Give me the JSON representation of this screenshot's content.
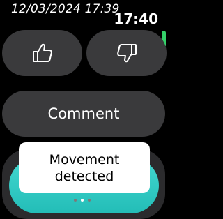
{
  "status_bar": {
    "timestamp": "12/03/2024 17:39",
    "clock": "17:40"
  },
  "actions": {
    "thumbs_up_icon": "thumbs-up-icon",
    "thumbs_down_icon": "thumbs-down-icon",
    "comment_label": "Comment"
  },
  "toast": {
    "line1": "Movement",
    "line2": "detected"
  },
  "pagination": {
    "total_pages": 3,
    "active_page": 2
  },
  "colors": {
    "background": "#000000",
    "pill": "#3a3a3c",
    "accent_teal": "#2fcfc8",
    "scroll_indicator": "#35d06a",
    "toast_background": "#ffffff"
  }
}
